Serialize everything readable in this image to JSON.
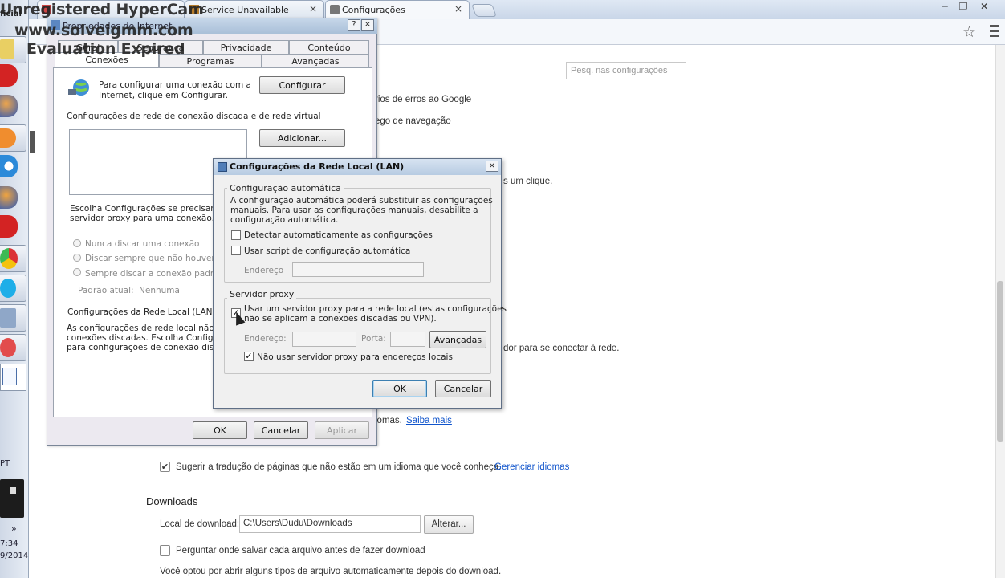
{
  "watermark": {
    "line1": "Unregistered HyperCam",
    "line2": "www.solveigmm.com",
    "line3": "Evaluation Expired"
  },
  "browser": {
    "tabs": [
      {
        "label": ""
      },
      {
        "label": "Service Unavailable"
      },
      {
        "label": "Configurações"
      }
    ],
    "tab_close": "×",
    "window_buttons": [
      "─",
      "❐",
      "✕"
    ]
  },
  "taskbar": {
    "top_label": "ficial",
    "pt_label": "PT",
    "chevron": "»",
    "clock_time": "7:34",
    "clock_date": "9/2014"
  },
  "settings": {
    "search_placeholder": "Pesq. nas configurações",
    "frag_errors": "rios de erros ao Google",
    "frag_traffic": "ego de navegação",
    "frag_oneclick": "s um clique.",
    "frag_proxy": "dor para se conectar à rede.",
    "frag_languages": "iomas.",
    "learn_more": "Saiba mais",
    "translate_label": "Sugerir a tradução de páginas que não estão em um idioma que você conheça.",
    "manage_languages": "Gerenciar idiomas",
    "downloads_heading": "Downloads",
    "download_location_label": "Local de download:",
    "download_path": "C:\\Users\\Dudu\\Downloads",
    "change_button": "Alterar...",
    "ask_where_label": "Perguntar onde salvar cada arquivo antes de fazer download",
    "auto_open_text": "Você optou por abrir alguns tipos de arquivo automaticamente depois do download."
  },
  "inet_properties": {
    "title": "Propriedades de Internet",
    "help_btn": "?",
    "close_btn": "×",
    "tabs_row1": [
      "Geral",
      "Segurança",
      "Privacidade",
      "Conteúdo"
    ],
    "tabs_row2": [
      "Conexões",
      "Programas",
      "Avançadas"
    ],
    "setup_text_1": "Para configurar uma conexão com a",
    "setup_text_2": "Internet, clique em Configurar.",
    "configure_button": "Configurar",
    "dialup_heading": "Configurações de rede de conexão discada e de rede virtual",
    "add_button": "Adicionar...",
    "choose_text_1": "Escolha Configurações se precisar confi",
    "choose_text_2": "servidor proxy para uma conexão.",
    "radio_never": "Nunca discar uma conexão",
    "radio_always_none": "Discar sempre que não houver uma",
    "radio_always_default": "Sempre discar a conexão padrão",
    "default_label": "Padrão atual:",
    "default_value": "Nenhuma",
    "lan_heading": "Configurações da Rede Local (LAN)",
    "lan_text_1": "As configurações de rede local não se ap",
    "lan_text_2": "conexões discadas. Escolha Configuraç",
    "lan_text_3": "para configurações de conexão discada.",
    "ok": "OK",
    "cancel": "Cancelar",
    "apply": "Aplicar"
  },
  "lan_dialog": {
    "title": "Configurações da Rede Local (LAN)",
    "close_btn": "×",
    "auto_group": "Configuração automática",
    "auto_desc_1": "A configuração automática poderá substituir as configurações",
    "auto_desc_2": "manuais. Para usar as configurações manuais, desabilite a",
    "auto_desc_3": "configuração automática.",
    "auto_detect_label": "Detectar automaticamente as configurações",
    "auto_detect_checked": false,
    "use_script_label": "Usar script de configuração automática",
    "use_script_checked": false,
    "address_label": "Endereço",
    "proxy_group": "Servidor proxy",
    "use_proxy_label_1": "Usar um servidor proxy para a rede local (estas configurações",
    "use_proxy_label_2": "não se aplicam a conexões discadas ou VPN).",
    "use_proxy_checked": true,
    "proxy_address_label": "Endereço:",
    "port_label": "Porta:",
    "advanced_button": "Avançadas",
    "bypass_label": "Não usar servidor proxy para endereços locais",
    "bypass_checked": true,
    "ok": "OK",
    "cancel": "Cancelar"
  }
}
